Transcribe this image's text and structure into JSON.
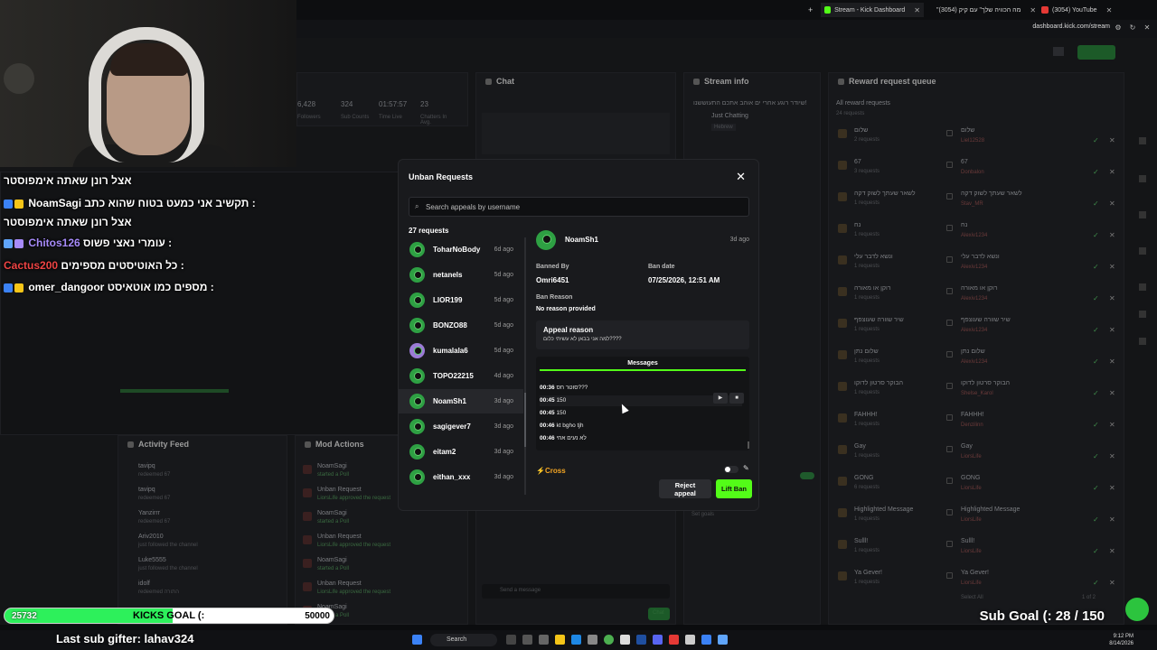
{
  "browser": {
    "tabs": [
      {
        "title": "Stream - Kick Dashboard",
        "color": "#53fc18"
      },
      {
        "title": "\"מה הכוויה שלך\" עם קיק (3054)",
        "color": "#e53935"
      },
      {
        "title": "(3054) YouTube",
        "color": "#e53935"
      }
    ],
    "url": "dashboard.kick.com/stream"
  },
  "dashboard": {
    "panels": {
      "chat": "Chat",
      "stream_info": "Stream info",
      "reward_queue": "Reward request queue",
      "activity_feed": "Activity Feed",
      "mod_actions": "Mod Actions"
    },
    "stats": {
      "followers_value": "6,428",
      "followers_label": "Followers",
      "sub_value": "324",
      "sub_label": "Sub Counts",
      "time_value": "01:57:57",
      "time_label": "Time Live",
      "chatters_value": "23",
      "chatters_label": "Chatters In Avg."
    },
    "stream_info": {
      "title": "שיודר רוגע אחרי ים אוהב אתכם התעוששנו!",
      "category": "Just Chatting",
      "tag": "Hebrew"
    },
    "reward_queue": {
      "header": "All reward requests",
      "count": "24 requests",
      "items": [
        {
          "title": "שלום",
          "requests": "2 requests",
          "user": "Liel12528"
        },
        {
          "title": "67",
          "requests": "3 requests",
          "user": "Donbalon"
        },
        {
          "title": "לשאר שעתך לשוק דקה",
          "requests": "1 requests",
          "user": "Stav_MR"
        },
        {
          "title": "נח",
          "requests": "1 requests",
          "user": "Alexiv1234"
        },
        {
          "title": "ונשא לדבר עלי",
          "requests": "1 requests",
          "user": "Alexiv1234"
        },
        {
          "title": "רוקן או מאורה",
          "requests": "1 requests",
          "user": "Alexiv1234"
        },
        {
          "title": "שיר שוורה שעוצפף",
          "requests": "1 requests",
          "user": "Alexiv1234"
        },
        {
          "title": "שלום נתן",
          "requests": "1 requests",
          "user": "Alexiv1234"
        },
        {
          "title": "הבוקר סרטון לדוקו",
          "requests": "1 requests",
          "user": "Shelse_Karol"
        },
        {
          "title": "FAHHH!",
          "requests": "1 requests",
          "user": "Denzilinn"
        },
        {
          "title": "Gay",
          "requests": "1 requests",
          "user": "LiorsLife"
        },
        {
          "title": "GONG",
          "requests": "6 requests",
          "user": "LiorsLife"
        },
        {
          "title": "Highlighted Message",
          "requests": "1 requests",
          "user": "LiorsLife"
        },
        {
          "title": "Sulll!",
          "requests": "1 requests",
          "user": "LiorsLife"
        },
        {
          "title": "Ya Gever!",
          "requests": "1 requests",
          "user": "LiorsLife"
        }
      ],
      "pagination": "1 of 2",
      "select_all": "Select All"
    },
    "activity": [
      {
        "name": "tavipq",
        "detail": "redeemed 67"
      },
      {
        "name": "tavipq",
        "detail": "redeemed 67"
      },
      {
        "name": "Yanzirrr",
        "detail": "redeemed 67"
      },
      {
        "name": "Ariv2010",
        "detail": "just followed the channel"
      },
      {
        "name": "Luke5555",
        "detail": "just followed the channel"
      },
      {
        "name": "idolf",
        "detail": "redeemed התורה"
      }
    ],
    "mod_actions": [
      {
        "name": "NoamSagi",
        "detail": "started a Poll"
      },
      {
        "name": "Unban Request",
        "detail": "LiorsLife approved the request"
      },
      {
        "name": "NoamSagi",
        "detail": "started a Poll"
      },
      {
        "name": "Unban Request",
        "detail": "LiorsLife approved the request"
      },
      {
        "name": "NoamSagi",
        "detail": "started a Poll"
      },
      {
        "name": "Unban Request",
        "detail": "LiorsLife approved the request"
      },
      {
        "name": "NoamSagi",
        "detail": "started a Poll"
      }
    ],
    "chat_bottom": {
      "send_placeholder": "Send a message",
      "send_button": "Chat"
    },
    "set_goals": "Set goals"
  },
  "overlay_chat": [
    {
      "user": "NoamSagi",
      "text": "אצל רונן שאתה אימפוסטר",
      "color": "#ffffff"
    },
    {
      "user": "NoamSagi",
      "text": "תקשיב אני כמעט בטוח שהוא כתב : ",
      "color": "#ffffff"
    },
    {
      "user": "",
      "text": "אצל רונן שאתה אימפוסטר",
      "color": "#ffffff"
    },
    {
      "user": "Chitos126",
      "text": "עומרי נאצי פשוס : ",
      "color": "#a78bfa"
    },
    {
      "user": "Cactus200",
      "text": "כל האוטיסטים מספימים : ",
      "color": "#ef4444"
    },
    {
      "user": "omer_dangoor",
      "text": "מספים כמו אוטאיסט : ",
      "color": "#ffffff"
    }
  ],
  "modal": {
    "title": "Unban Requests",
    "search_placeholder": "Search appeals by username",
    "request_count": "27 requests",
    "requests": [
      {
        "name": "ToharNoBody",
        "time": "6d ago"
      },
      {
        "name": "netanels",
        "time": "5d ago"
      },
      {
        "name": "LIOR199",
        "time": "5d ago"
      },
      {
        "name": "BONZO88",
        "time": "5d ago"
      },
      {
        "name": "kumalala6",
        "time": "5d ago"
      },
      {
        "name": "TOPO22215",
        "time": "4d ago"
      },
      {
        "name": "NoamSh1",
        "time": "3d ago"
      },
      {
        "name": "sagigever7",
        "time": "3d ago"
      },
      {
        "name": "eitam2",
        "time": "3d ago"
      },
      {
        "name": "eithan_xxx",
        "time": "3d ago"
      }
    ],
    "selected_index": 6,
    "detail": {
      "name": "NoamSh1",
      "ago": "3d ago",
      "banned_by_label": "Banned By",
      "banned_by": "Omri6451",
      "ban_date_label": "Ban date",
      "ban_date": "07/25/2026, 12:51 AM",
      "ban_reason_label": "Ban Reason",
      "ban_reason": "No reason provided",
      "appeal_title": "Appeal reason",
      "appeal_text": "למה אני בבאן לא עשיתי כלום????",
      "messages_tab": "Messages",
      "messages": [
        {
          "time": "00:36",
          "text": "סוטר חס???"
        },
        {
          "time": "00:45",
          "text": "150"
        },
        {
          "time": "00:45",
          "text": "150"
        },
        {
          "time": "00:46",
          "text": "kt bgho tjh"
        },
        {
          "time": "00:46",
          "text": "לא נעים אחי"
        }
      ],
      "cross_label": "Cross",
      "reject_button": "Reject appeal",
      "lift_button": "Lift Ban"
    }
  },
  "stream_overlay": {
    "kick_current": "25732",
    "kick_label": "KICKS GOAL (:",
    "kick_max": "50000",
    "kick_progress": 0.51,
    "last_sub": "Last sub gifter: lahav324",
    "sub_goal": "Sub Goal (: 28 / 150"
  },
  "taskbar": {
    "search": "Search",
    "time": "9:12 PM",
    "date": "8/14/2026"
  }
}
